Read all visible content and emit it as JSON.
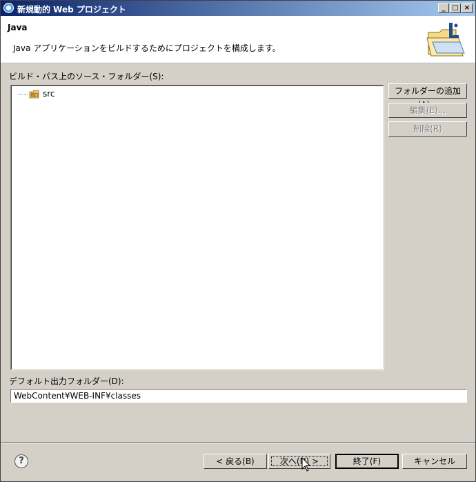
{
  "window": {
    "title": "新規動的 Web プロジェクト",
    "controls": {
      "minimize": "_",
      "maximize": "□",
      "close": "×"
    }
  },
  "header": {
    "title": "Java",
    "description": "Java アプリケーションをビルドするためにプロジェクトを構成します。"
  },
  "source_folders": {
    "label": "ビルド・パス上のソース・フォルダー(S):",
    "items": [
      {
        "label": "src",
        "icon": "source-package-icon"
      }
    ]
  },
  "side_buttons": {
    "add_folder": "フォルダーの追加(A)...",
    "edit": "編集(E)...",
    "remove": "削除(R)"
  },
  "output_folder": {
    "label": "デフォルト出力フォルダー(D):",
    "value": "WebContent¥WEB-INF¥classes"
  },
  "footer": {
    "help": "?",
    "back": "< 戻る(B)",
    "next": "次へ(N) >",
    "finish": "終了(F)",
    "cancel": "キャンセル"
  }
}
